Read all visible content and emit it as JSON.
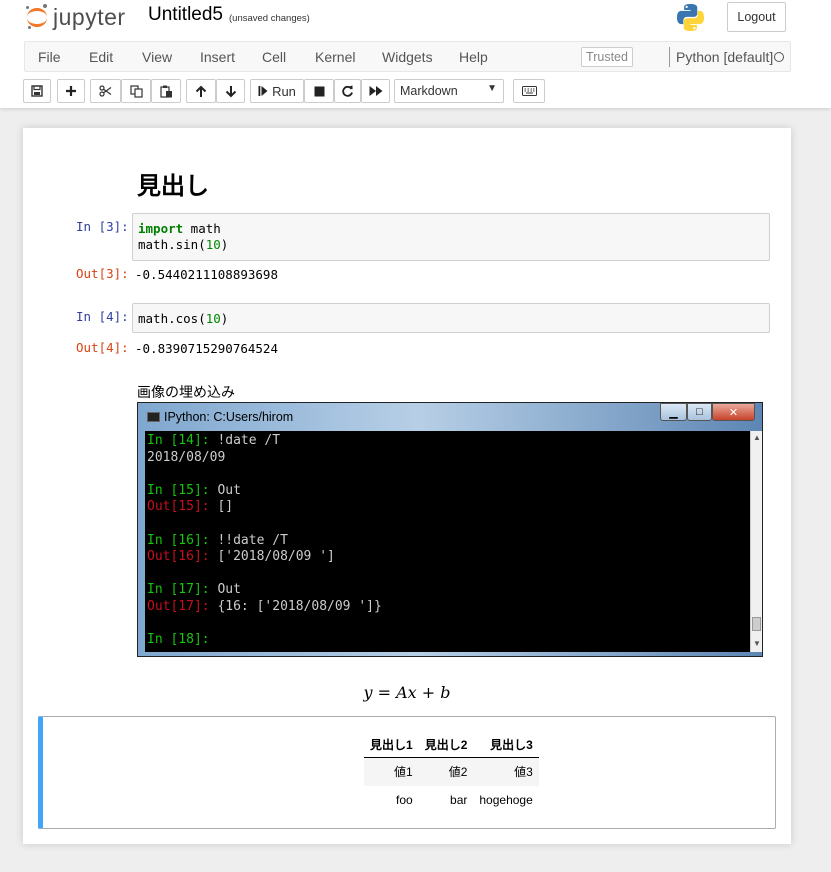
{
  "header": {
    "brand": "jupyter",
    "notebook_name": "Untitled5",
    "save_status": "(unsaved changes)",
    "logout_label": "Logout"
  },
  "menubar": {
    "items": [
      "File",
      "Edit",
      "View",
      "Insert",
      "Cell",
      "Kernel",
      "Widgets",
      "Help"
    ],
    "trusted_label": "Trusted",
    "kernel_name": "Python [default]"
  },
  "toolbar": {
    "run_label": "Run",
    "cell_type": "Markdown"
  },
  "notebook": {
    "heading": "見出し",
    "cells": [
      {
        "in_prompt": "In [3]:",
        "code_line1_kw": "import",
        "code_line1_rest": " math",
        "code_line2_pre": "math.sin(",
        "code_line2_num": "10",
        "code_line2_post": ")",
        "out_prompt": "Out[3]:",
        "output": "-0.5440211108893698"
      },
      {
        "in_prompt": "In [4]:",
        "code_line1_pre": "math.cos(",
        "code_line1_num": "10",
        "code_line1_post": ")",
        "out_prompt": "Out[4]:",
        "output": "-0.8390715290764524"
      }
    ],
    "image_caption": "画像の埋め込み",
    "console": {
      "title": "IPython: C:Users/hirom",
      "lines": [
        {
          "prompt": "In [14]: ",
          "prompt_color": "green",
          "text": "!date /T"
        },
        {
          "prompt": "",
          "prompt_color": "white",
          "text": "2018/08/09"
        },
        {
          "prompt": "",
          "prompt_color": "white",
          "text": ""
        },
        {
          "prompt": "In [15]: ",
          "prompt_color": "green",
          "text": "Out"
        },
        {
          "prompt": "Out[15]: ",
          "prompt_color": "red",
          "text": "[]"
        },
        {
          "prompt": "",
          "prompt_color": "white",
          "text": ""
        },
        {
          "prompt": "In [16]: ",
          "prompt_color": "green",
          "text": "!!date /T"
        },
        {
          "prompt": "Out[16]: ",
          "prompt_color": "red",
          "text": "['2018/08/09 ']"
        },
        {
          "prompt": "",
          "prompt_color": "white",
          "text": ""
        },
        {
          "prompt": "In [17]: ",
          "prompt_color": "green",
          "text": "Out"
        },
        {
          "prompt": "Out[17]: ",
          "prompt_color": "red",
          "text": "{16: ['2018/08/09 ']}"
        },
        {
          "prompt": "",
          "prompt_color": "white",
          "text": ""
        },
        {
          "prompt": "In [18]:",
          "prompt_color": "green",
          "text": ""
        }
      ]
    },
    "math": {
      "lhs": "y",
      "eq": " = ",
      "rhs1": "Ax",
      "plus": " + ",
      "rhs2": "b"
    },
    "table": {
      "headers": [
        "見出し1",
        "見出し2",
        "見出し3"
      ],
      "rows": [
        [
          "値1",
          "値2",
          "値3"
        ],
        [
          "foo",
          "bar",
          "hogehoge"
        ]
      ]
    }
  },
  "colors": {
    "brand_orange": "#f37726",
    "in_prompt": "#303f9f",
    "out_prompt": "#d84315",
    "selected_cell_border": "#42a5f5"
  }
}
